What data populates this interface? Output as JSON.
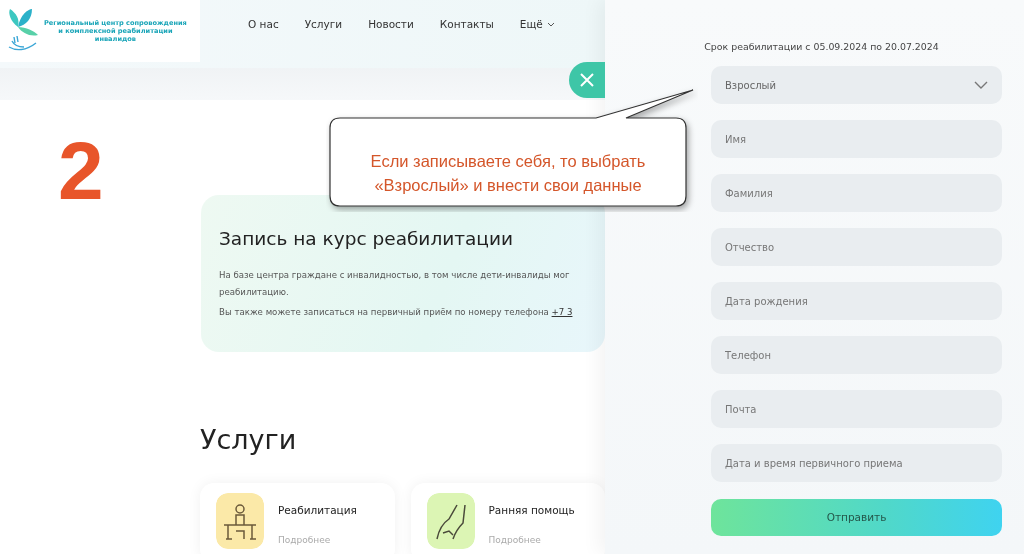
{
  "header": {
    "logo_text": "Региональный центр сопровождения\nи комплексной реабилитации\nинвалидов",
    "nav": [
      {
        "label": "О нас",
        "kind": "link"
      },
      {
        "label": "Услуги",
        "kind": "link"
      },
      {
        "label": "Новости",
        "kind": "link"
      },
      {
        "label": "Контакты",
        "kind": "link"
      },
      {
        "label": "Ещё",
        "kind": "dropdown"
      }
    ]
  },
  "step_number": "2",
  "card": {
    "title": "Запись на курс реабилитации",
    "text": "На базе центра граждане с инвалидностью, в том числе дети-инвалиды мог\nреабилитацию.",
    "phone_text": "Вы также можете записаться на первичный приём по номеру телефона",
    "phone": "+7 3"
  },
  "services": {
    "title": "Услуги",
    "items": [
      {
        "title": "Реабилитация",
        "link": "Подробнее",
        "kind": "desk"
      },
      {
        "title": "Ранняя помощь",
        "link": "Подробнее",
        "kind": "hand"
      }
    ]
  },
  "callout": {
    "text": "Если записываете себя, то выбрать\n«Взрослый» и внести свои данные"
  },
  "form": {
    "period": "Срок реабилитации с 05.09.2024 по 20.07.2024",
    "fields": [
      {
        "kind": "select",
        "value": "Взрослый"
      },
      {
        "kind": "input",
        "placeholder": "Имя"
      },
      {
        "kind": "input",
        "placeholder": "Фамилия"
      },
      {
        "kind": "input",
        "placeholder": "Отчество"
      },
      {
        "kind": "input",
        "placeholder": "Дата рождения"
      },
      {
        "kind": "input",
        "placeholder": "Телефон"
      },
      {
        "kind": "input",
        "placeholder": "Почта"
      },
      {
        "kind": "input",
        "placeholder": "Дата и время первичного приема"
      }
    ],
    "submit": "Отправить"
  }
}
